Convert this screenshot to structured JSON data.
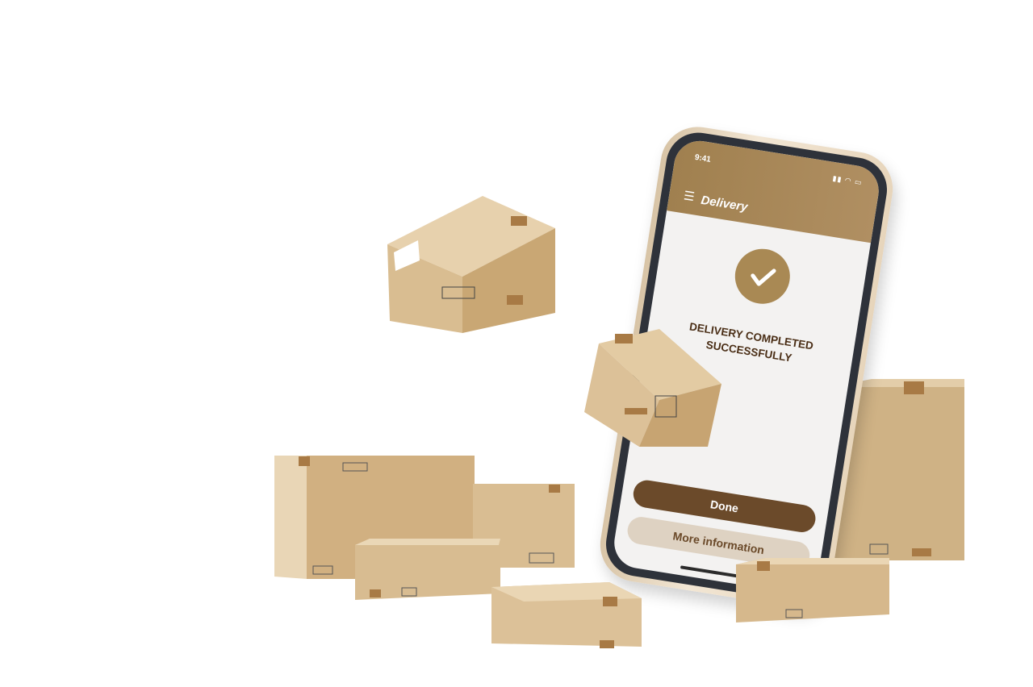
{
  "phone": {
    "status_time": "9:41",
    "header": {
      "menu_icon": "menu-icon",
      "title": "Delivery"
    },
    "message_line1": "DELIVERY COMPLETED",
    "message_line2": "SUCCESSFULLY",
    "check_icon": "check-icon",
    "done_label": "Done",
    "more_info_label": "More information"
  },
  "colors": {
    "header": "#a0804f",
    "accent": "#a98954",
    "button_primary": "#6b4a2a",
    "button_secondary": "#ded2c2",
    "message_text": "#4a2e16",
    "box_cardboard": "#d8bc91"
  }
}
